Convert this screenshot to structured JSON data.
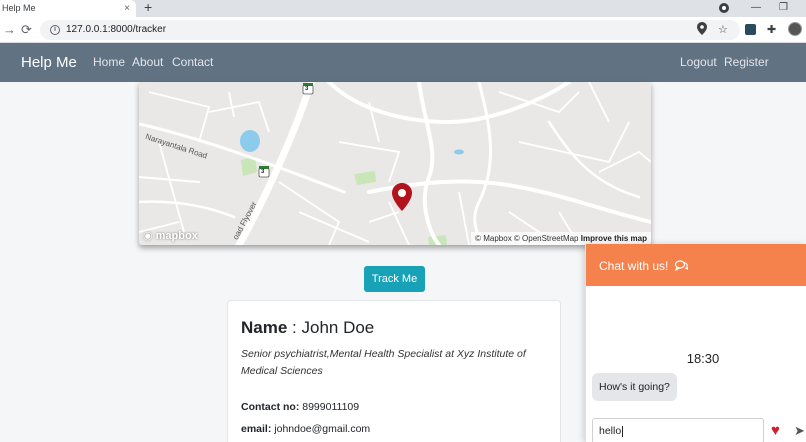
{
  "browser": {
    "tab_title": "Help Me",
    "tab_close": "×",
    "new_tab": "+",
    "url": "127.0.0.1:8000/tracker",
    "minimize": "—",
    "restore": "❐"
  },
  "navbar": {
    "brand": "Help Me",
    "links": [
      "Home",
      "About",
      "Contact"
    ],
    "right_links": [
      "Logout",
      "Register"
    ],
    "background": "#617283"
  },
  "map": {
    "street_label_1": "Narayantala Road",
    "street_label_2": "oad Flyover",
    "route_badge": "3",
    "logo": "mapbox",
    "attribution": "© Mapbox © OpenStreetMap",
    "improve_link": "Improve this map",
    "marker_color": "#b3141c"
  },
  "track_button": {
    "label": "Track Me",
    "color": "#17a2b8"
  },
  "profile": {
    "name_label": "Name",
    "name_sep": " : ",
    "name": "John Doe",
    "description": "Senior psychiatrist,Mental Health Specialist at Xyz Institute of Medical Sciences",
    "contact_label": "Contact no:",
    "contact_value": "8999011109",
    "email_label": "email:",
    "email_value": "johndoe@gmail.com"
  },
  "chat": {
    "header": "Chat with us!",
    "header_icon": "chat-bubbles-icon",
    "header_color": "#f5824c",
    "time": "18:30",
    "message": "How's it going?",
    "input_value": "hello",
    "heart_icon": "heart-icon",
    "send_icon": "send-icon"
  }
}
